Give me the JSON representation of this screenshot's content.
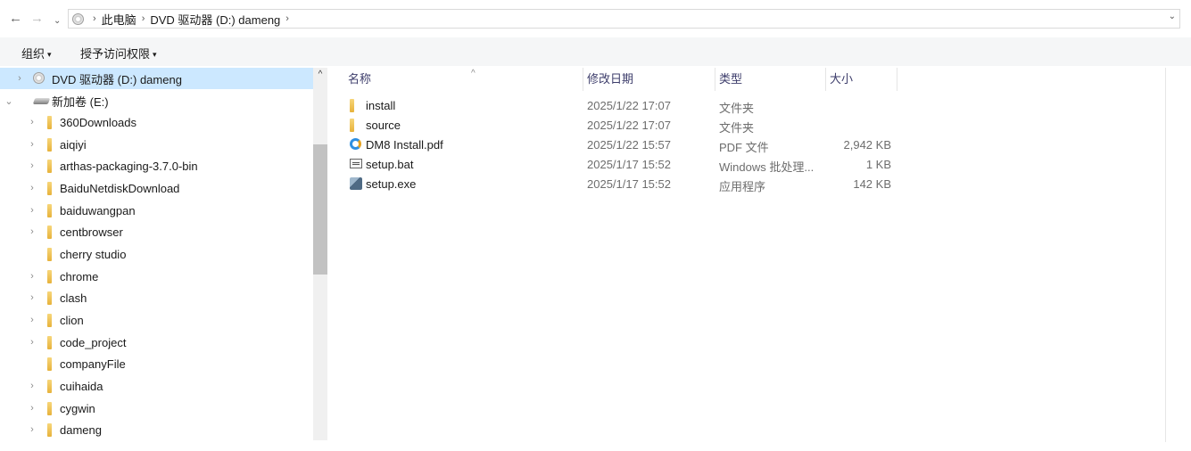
{
  "address_bar": {
    "back_glyph": "←",
    "forward_glyph": "→",
    "recent_glyph": "⌄",
    "location_icon": "disc-drive-icon",
    "breadcrumb": [
      "此电脑",
      "DVD 驱动器 (D:) dameng"
    ],
    "separator": "›",
    "dropdown_glyph": "⌄"
  },
  "toolbar": {
    "organize_label": "组织",
    "grant_access_label": "授予访问权限",
    "caret": "▾"
  },
  "nav_tree": {
    "items": [
      {
        "label": "DVD 驱动器 (D:) dameng",
        "icon": "disc-drive-icon",
        "expander": "›",
        "selected": true
      },
      {
        "label": "新加卷 (E:)",
        "icon": "drive-icon",
        "expander": "⌄"
      },
      {
        "label": "360Downloads",
        "icon": "folder-icon",
        "expander": "›"
      },
      {
        "label": "aiqiyi",
        "icon": "folder-icon",
        "expander": "›"
      },
      {
        "label": "arthas-packaging-3.7.0-bin",
        "icon": "folder-icon",
        "expander": "›"
      },
      {
        "label": "BaiduNetdiskDownload",
        "icon": "folder-icon",
        "expander": "›"
      },
      {
        "label": "baiduwangpan",
        "icon": "folder-icon",
        "expander": "›"
      },
      {
        "label": "centbrowser",
        "icon": "folder-icon",
        "expander": "›"
      },
      {
        "label": "cherry studio",
        "icon": "folder-icon",
        "expander": ""
      },
      {
        "label": "chrome",
        "icon": "folder-icon",
        "expander": "›"
      },
      {
        "label": "clash",
        "icon": "folder-icon",
        "expander": "›"
      },
      {
        "label": "clion",
        "icon": "folder-icon",
        "expander": "›"
      },
      {
        "label": "code_project",
        "icon": "folder-icon",
        "expander": "›"
      },
      {
        "label": "companyFile",
        "icon": "folder-icon",
        "expander": ""
      },
      {
        "label": "cuihaida",
        "icon": "folder-icon",
        "expander": "›"
      },
      {
        "label": "cygwin",
        "icon": "folder-icon",
        "expander": "›"
      },
      {
        "label": "dameng",
        "icon": "folder-icon",
        "expander": "›"
      }
    ],
    "scroll_up_glyph": "^"
  },
  "file_list": {
    "columns": {
      "name": "名称",
      "modified": "修改日期",
      "type": "类型",
      "size": "大小"
    },
    "sort_glyph": "^",
    "rows": [
      {
        "name": "install",
        "modified": "2025/1/22 17:07",
        "type": "文件夹",
        "size": "",
        "icon": "folder-icon"
      },
      {
        "name": "source",
        "modified": "2025/1/22 17:07",
        "type": "文件夹",
        "size": "",
        "icon": "folder-icon"
      },
      {
        "name": "DM8 Install.pdf",
        "modified": "2025/1/22 15:57",
        "type": "PDF 文件",
        "size": "2,942 KB",
        "icon": "pdf-icon"
      },
      {
        "name": "setup.bat",
        "modified": "2025/1/17 15:52",
        "type": "Windows 批处理...",
        "size": "1 KB",
        "icon": "bat-file-icon"
      },
      {
        "name": "setup.exe",
        "modified": "2025/1/17 15:52",
        "type": "应用程序",
        "size": "142 KB",
        "icon": "exe-icon"
      }
    ]
  },
  "colors": {
    "selection": "#cce8ff",
    "toolbar_bg": "#f5f6f7",
    "header_text": "#3d3d6b",
    "meta_text": "#6d6d6d"
  }
}
